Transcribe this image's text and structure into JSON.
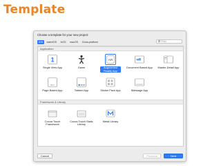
{
  "slide_title": "Template",
  "dialog": {
    "prompt": "Choose a template for your new project:",
    "platform_tabs": [
      {
        "label": "iOS",
        "active": true
      },
      {
        "label": "watchOS",
        "active": false
      },
      {
        "label": "tvOS",
        "active": false
      },
      {
        "label": "macOS",
        "active": false
      },
      {
        "label": "Cross-platform",
        "active": false
      }
    ],
    "filter_placeholder": "Filter",
    "sections": [
      {
        "title": "Application",
        "templates": [
          {
            "label": "Single View App",
            "icon": "single-view-icon",
            "selected": false
          },
          {
            "label": "Game",
            "icon": "game-icon",
            "selected": false
          },
          {
            "label": "Augmented Reality App",
            "icon": "ar-icon",
            "selected": true
          },
          {
            "label": "Document Based App",
            "icon": "document-icon",
            "selected": false
          },
          {
            "label": "Master-Detail App",
            "icon": "master-detail-icon",
            "selected": false
          },
          {
            "label": "Page-Based App",
            "icon": "page-based-icon",
            "selected": false
          },
          {
            "label": "Tabbed App",
            "icon": "tabbed-icon",
            "selected": false
          },
          {
            "label": "Sticker Pack App",
            "icon": "sticker-icon",
            "selected": false
          },
          {
            "label": "iMessage App",
            "icon": "imessage-icon",
            "selected": false
          }
        ]
      },
      {
        "title": "Framework & Library",
        "templates": [
          {
            "label": "Cocoa Touch Framework",
            "icon": "framework-icon",
            "selected": false
          },
          {
            "label": "Cocoa Touch Static Library",
            "icon": "static-library-icon",
            "selected": false
          },
          {
            "label": "Metal Library",
            "icon": "metal-icon",
            "selected": false
          }
        ]
      }
    ],
    "buttons": {
      "cancel": "Cancel",
      "previous": "Previous",
      "next": "Next"
    }
  },
  "colors": {
    "title": "#e8842a",
    "accent": "#2f7cf6"
  }
}
